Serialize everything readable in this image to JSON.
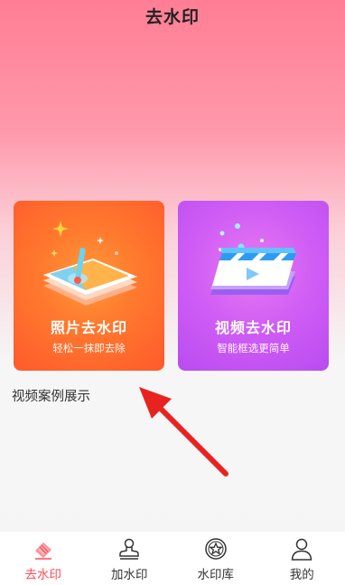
{
  "header": {
    "title": "去水印"
  },
  "cards": {
    "photo": {
      "title": "照片去水印",
      "subtitle": "轻松一抹即去除",
      "color": "#ff6a2c",
      "icon": "photo-edit-icon"
    },
    "video": {
      "title": "视频去水印",
      "subtitle": "智能框选更简单",
      "color": "#cc5cf4",
      "icon": "video-clapper-icon"
    }
  },
  "section": {
    "title": "视频案例展示"
  },
  "tabbar": {
    "active_color": "#ff4b57",
    "items": [
      {
        "label": "去水印",
        "icon": "eraser-icon",
        "active": true
      },
      {
        "label": "加水印",
        "icon": "stamp-icon",
        "active": false
      },
      {
        "label": "水印库",
        "icon": "seal-star-icon",
        "active": false
      },
      {
        "label": "我的",
        "icon": "user-icon",
        "active": false
      }
    ]
  },
  "annotation": {
    "arrow_color": "#e8231f"
  }
}
